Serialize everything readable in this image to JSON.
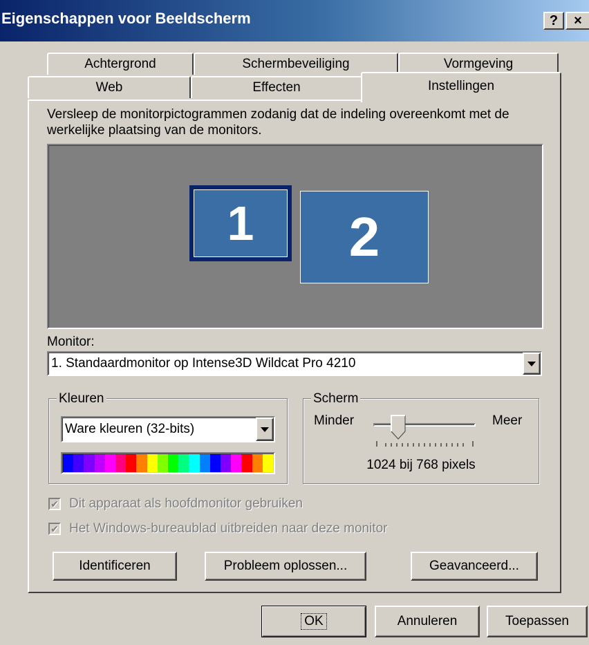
{
  "window": {
    "title": "Eigenschappen voor Beeldscherm",
    "help_label": "?",
    "close_label": "×"
  },
  "tabs": {
    "row_back": [
      {
        "label": "Achtergrond"
      },
      {
        "label": "Schermbeveiliging"
      },
      {
        "label": "Vormgeving"
      }
    ],
    "row_front": [
      {
        "label": "Web"
      },
      {
        "label": "Effecten"
      },
      {
        "label": "Instellingen",
        "active": true
      }
    ]
  },
  "settings": {
    "instruction": "Versleep de monitorpictogrammen zodanig dat de indeling overeenkomt met de werkelijke plaatsing van de monitors.",
    "monitors": [
      {
        "number": "1",
        "selected": true
      },
      {
        "number": "2",
        "selected": false
      }
    ],
    "monitor_label": "Monitor:",
    "monitor_selected": "1. Standaardmonitor op Intense3D Wildcat Pro 4210",
    "colors_group": {
      "label": "Kleuren",
      "selected": "Ware kleuren (32-bits)",
      "swatch_colors": [
        "#0000ff",
        "#4000ff",
        "#8000ff",
        "#c000ff",
        "#ff00ff",
        "#ff0080",
        "#ff0000",
        "#ff8000",
        "#ffff00",
        "#80ff00",
        "#00ff00",
        "#00ff80",
        "#00ffff",
        "#0080ff",
        "#0000ff",
        "#8000ff",
        "#ff00ff",
        "#ff0000",
        "#ff8000",
        "#ffff00"
      ]
    },
    "screen_group": {
      "label": "Scherm",
      "min_label": "Minder",
      "max_label": "Meer",
      "slider_fraction": 0.2,
      "resolution": "1024 bij 768 pixels"
    },
    "checkbox_primary": {
      "label": "Dit apparaat als hoofdmonitor gebruiken",
      "checked": true,
      "enabled": false
    },
    "checkbox_extend": {
      "label": "Het Windows-bureaublad uitbreiden naar deze monitor",
      "checked": true,
      "enabled": false
    },
    "buttons": {
      "identify": "Identificeren",
      "troubleshoot": "Probleem oplossen...",
      "advanced": "Geavanceerd..."
    }
  },
  "dialog_buttons": {
    "ok": "OK",
    "cancel": "Annuleren",
    "apply": "Toepassen"
  }
}
